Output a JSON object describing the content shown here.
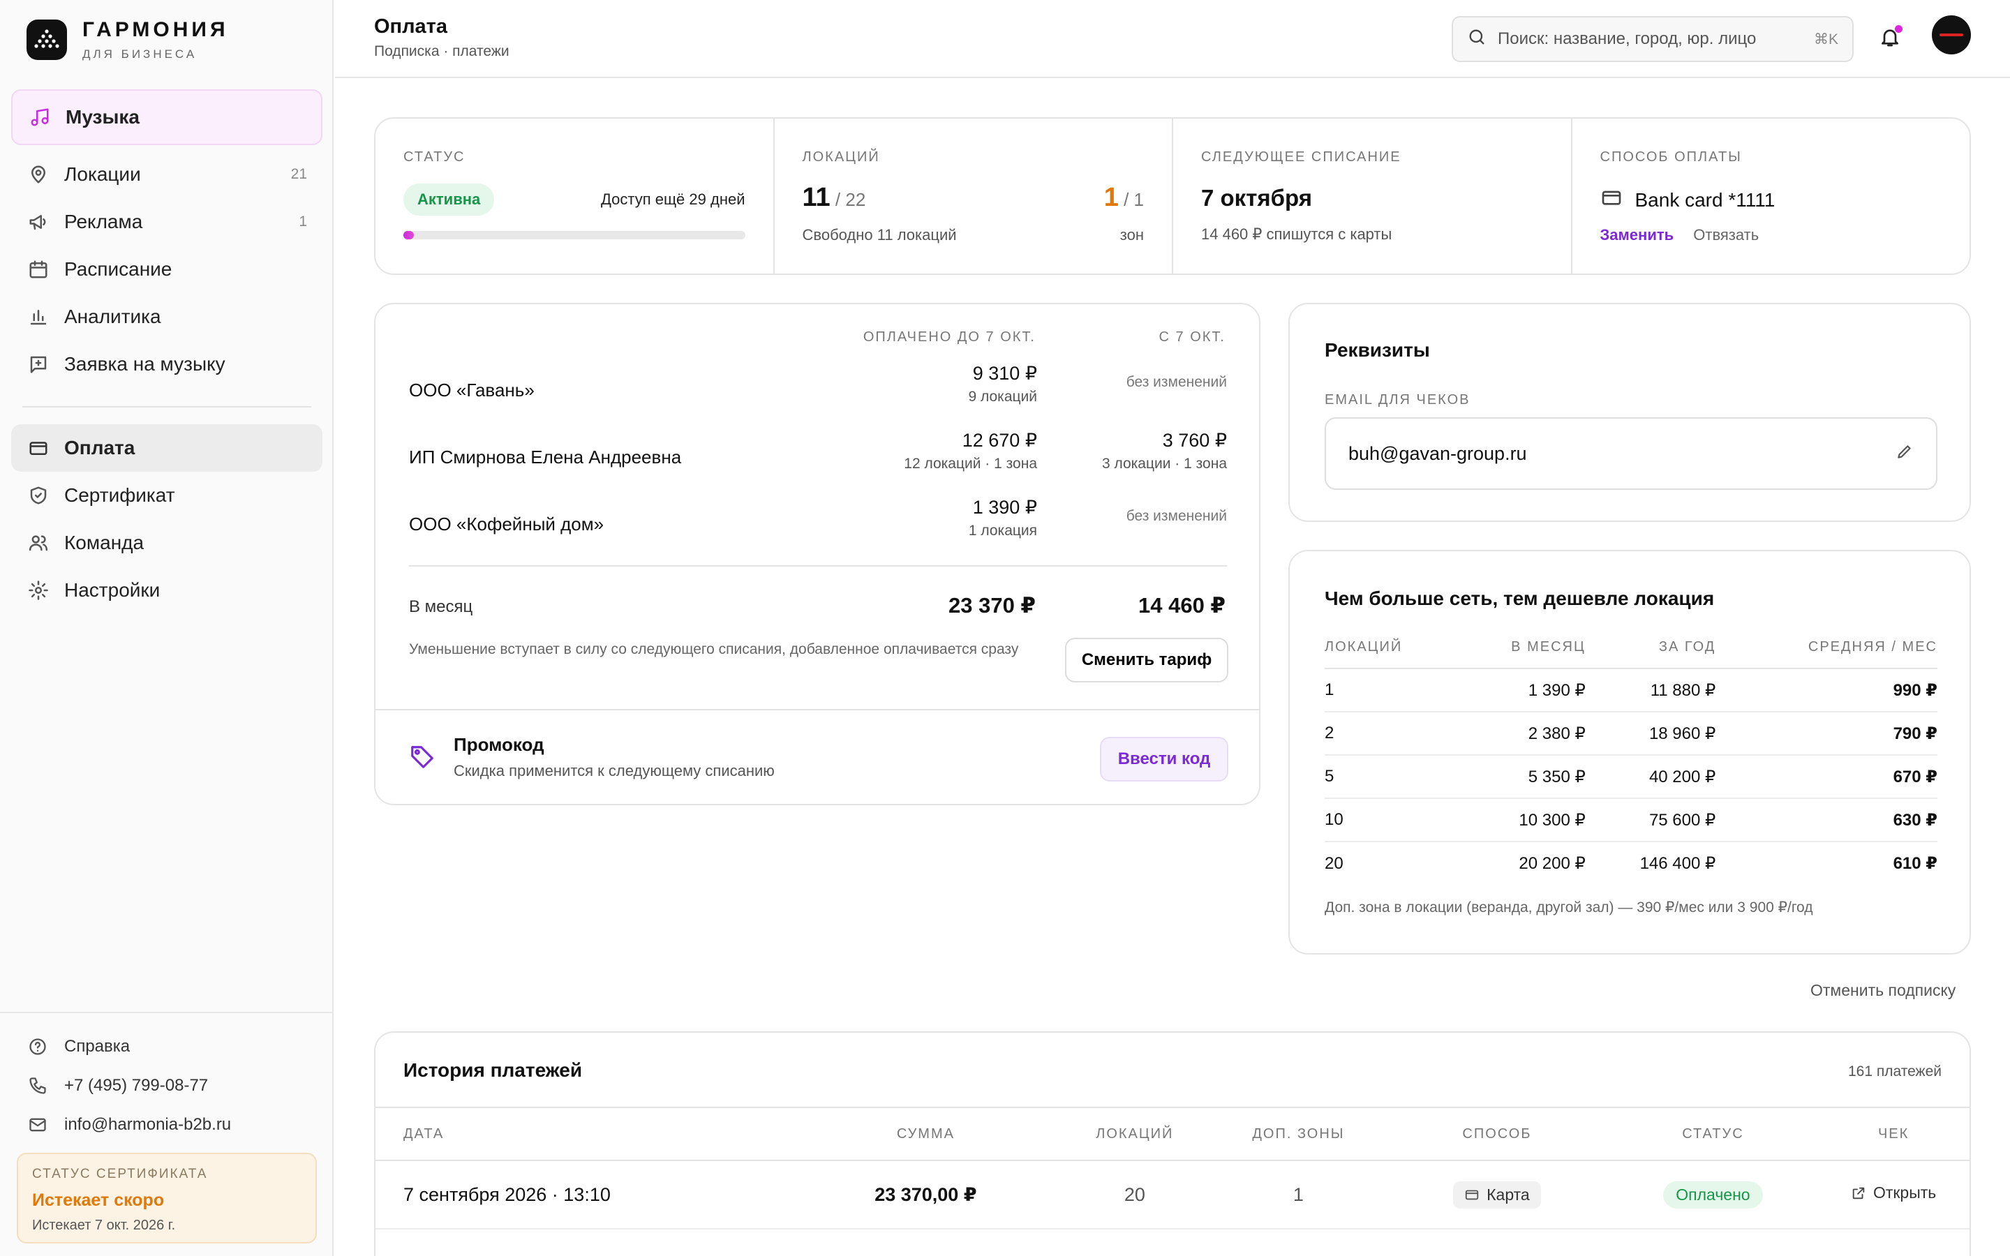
{
  "brand": {
    "name": "ГАРМОНИЯ",
    "subtitle": "ДЛЯ БИЗНЕСА"
  },
  "nav": {
    "music": "Музыка",
    "items": [
      {
        "label": "Локации",
        "count": "21",
        "icon": "map-pin-icon"
      },
      {
        "label": "Реклама",
        "count": "1",
        "icon": "megaphone-icon"
      },
      {
        "label": "Расписание",
        "count": "",
        "icon": "calendar-icon"
      },
      {
        "label": "Аналитика",
        "count": "",
        "icon": "bar-chart-icon"
      },
      {
        "label": "Заявка на музыку",
        "count": "",
        "icon": "request-icon"
      }
    ],
    "secondary": [
      {
        "label": "Оплата",
        "icon": "card-icon"
      },
      {
        "label": "Сертификат",
        "icon": "shield-icon"
      },
      {
        "label": "Команда",
        "icon": "users-icon"
      },
      {
        "label": "Настройки",
        "icon": "gear-icon"
      }
    ]
  },
  "footer": {
    "help": "Справка",
    "phone": "+7 (495) 799-08-77",
    "email": "info@harmonia-b2b.ru"
  },
  "certificate": {
    "label": "СТАТУС СЕРТИФИКАТА",
    "title": "Истекает скоро",
    "date": "Истекает 7 окт. 2026 г."
  },
  "header": {
    "title": "Оплата",
    "subtitle": "Подписка · платежи",
    "search_placeholder": "Поиск: название, город, юр. лицо",
    "shortcut": "⌘K"
  },
  "stats": {
    "status": {
      "label": "СТАТУС",
      "badge": "Активна",
      "days": "Доступ ещё 29 дней",
      "progress": 0.03
    },
    "locations": {
      "label": "ЛОКАЦИЙ",
      "value": "11",
      "total": "/ 22",
      "free": "Свободно 11 локаций",
      "zones_value": "1",
      "zones_total": "/ 1",
      "zones_label": "зон"
    },
    "next": {
      "label": "СЛЕДУЮЩЕЕ СПИСАНИЕ",
      "date": "7 октября",
      "sub": "14 460 ₽ спишутся с карты"
    },
    "method": {
      "label": "СПОСОБ ОПЛАТЫ",
      "card": "Bank card *1111",
      "change": "Заменить",
      "unlink": "Отвязать"
    }
  },
  "plans": {
    "col1": "ОПЛАЧЕНО ДО 7 ОКТ.",
    "col2": "С 7 ОКТ.",
    "rows": [
      {
        "name": "ООО «Гавань»",
        "v1": "9 310 ₽",
        "s1": "9 локаций",
        "v2": "",
        "s2": "без изменений"
      },
      {
        "name": "ИП Смирнова Елена Андреевна",
        "v1": "12 670 ₽",
        "s1": "12 локаций · 1 зона",
        "v2": "3 760 ₽",
        "s2": "3 локации · 1 зона"
      },
      {
        "name": "ООО «Кофейный дом»",
        "v1": "1 390 ₽",
        "s1": "1 локация",
        "v2": "",
        "s2": "без изменений"
      }
    ],
    "month_label": "В месяц",
    "month_v1": "23 370 ₽",
    "month_v2": "14 460 ₽",
    "note": "Уменьшение вступает в силу со следующего списания, добавленное оплачивается сразу",
    "change_button": "Сменить тариф",
    "promo_title": "Промокод",
    "promo_sub": "Скидка применится к следующему списанию",
    "promo_button": "Ввести код"
  },
  "requisites": {
    "title": "Реквизиты",
    "email_label": "EMAIL ДЛЯ ЧЕКОВ",
    "email": "buh@gavan-group.ru"
  },
  "tiers": {
    "title": "Чем больше сеть, тем дешевле локация",
    "headers": [
      "ЛОКАЦИЙ",
      "В МЕСЯЦ",
      "ЗА ГОД",
      "СРЕДНЯЯ / МЕС"
    ],
    "rows": [
      [
        "1",
        "1 390 ₽",
        "11 880 ₽",
        "990 ₽"
      ],
      [
        "2",
        "2 380 ₽",
        "18 960 ₽",
        "790 ₽"
      ],
      [
        "5",
        "5 350 ₽",
        "40 200 ₽",
        "670 ₽"
      ],
      [
        "10",
        "10 300 ₽",
        "75 600 ₽",
        "630 ₽"
      ],
      [
        "20",
        "20 200 ₽",
        "146 400 ₽",
        "610 ₽"
      ]
    ],
    "note": "Доп. зона в локации (веранда, другой зал) — 390 ₽/мес или 3 900 ₽/год"
  },
  "cancel_link": "Отменить подписку",
  "history": {
    "title": "История платежей",
    "count": "161 платежей",
    "headers": [
      "ДАТА",
      "СУММА",
      "ЛОКАЦИЙ",
      "ДОП. ЗОНЫ",
      "СПОСОБ",
      "СТАТУС",
      "ЧЕК"
    ],
    "rows": [
      {
        "date": "7 сентября 2026 · 13:10",
        "sum": "23 370,00 ₽",
        "locations": "20",
        "zones": "1",
        "method": "Карта",
        "status": "Оплачено",
        "check": "Открыть"
      }
    ]
  }
}
